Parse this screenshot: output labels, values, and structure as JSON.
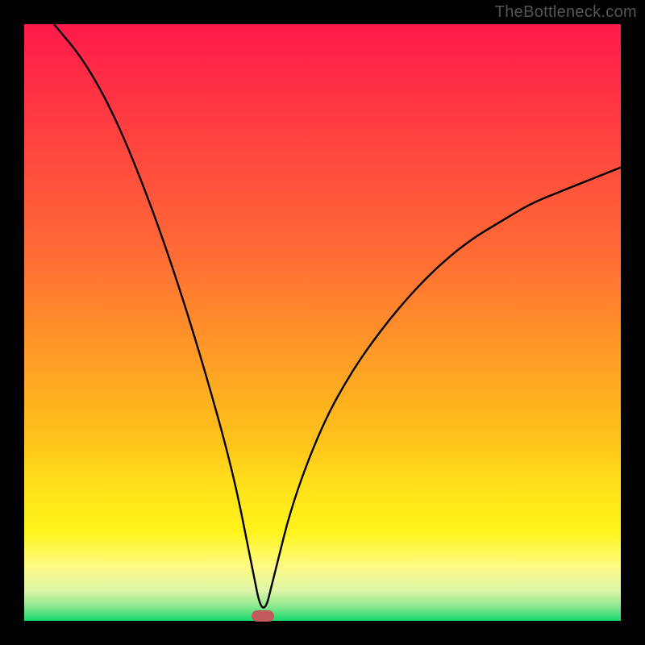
{
  "watermark": "TheBottleneck.com",
  "colors": {
    "gradient": [
      "#ff1a4a",
      "#ff6a35",
      "#ffc41a",
      "#ffe31a",
      "#fff31a",
      "#fffb85",
      "#dcf5a8",
      "#8fe88f",
      "#14d96e"
    ],
    "curve": "#000000",
    "marker": "#c15a5a",
    "frame": "#000000"
  },
  "chart_data": {
    "type": "line",
    "title": "",
    "xlabel": "",
    "ylabel": "",
    "xlim": [
      0,
      100
    ],
    "ylim": [
      0,
      100
    ],
    "minimum_x": 40,
    "series": [
      {
        "name": "curve",
        "x": [
          5,
          10,
          15,
          20,
          25,
          30,
          35,
          38,
          40,
          42,
          45,
          50,
          55,
          60,
          65,
          70,
          75,
          80,
          85,
          90,
          95,
          100
        ],
        "y": [
          100,
          94,
          85,
          73,
          59,
          43,
          25,
          10,
          0,
          8,
          20,
          33,
          42,
          49,
          55,
          60,
          64,
          67,
          70,
          72,
          74,
          76
        ]
      }
    ],
    "marker": {
      "x": 40,
      "y": 0
    }
  }
}
